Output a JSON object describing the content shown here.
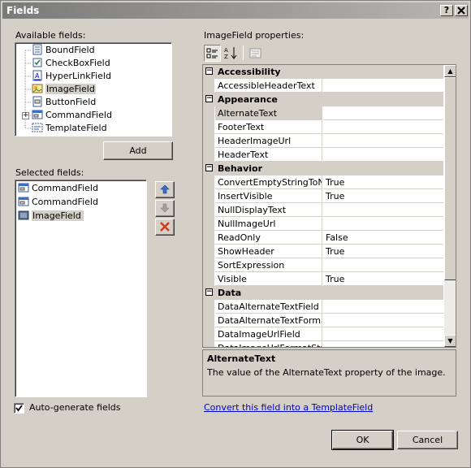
{
  "window": {
    "title": "Fields",
    "help_button": "?",
    "close_button": "X"
  },
  "available": {
    "label": "Available fields:",
    "items": [
      "BoundField",
      "CheckBoxField",
      "HyperLinkField",
      "ImageField",
      "ButtonField",
      "CommandField",
      "TemplateField"
    ]
  },
  "add_button": "Add",
  "selected": {
    "label": "Selected fields:",
    "items": [
      "CommandField",
      "CommandField",
      "ImageField"
    ]
  },
  "autogen": {
    "label": "Auto-generate fields",
    "checked": true
  },
  "properties": {
    "label": "ImageField properties:",
    "categories": [
      {
        "name": "Accessibility",
        "items": [
          {
            "name": "AccessibleHeaderText",
            "value": ""
          }
        ]
      },
      {
        "name": "Appearance",
        "items": [
          {
            "name": "AlternateText",
            "value": ""
          },
          {
            "name": "FooterText",
            "value": ""
          },
          {
            "name": "HeaderImageUrl",
            "value": ""
          },
          {
            "name": "HeaderText",
            "value": ""
          }
        ]
      },
      {
        "name": "Behavior",
        "items": [
          {
            "name": "ConvertEmptyStringToNull",
            "value": "True"
          },
          {
            "name": "InsertVisible",
            "value": "True"
          },
          {
            "name": "NullDisplayText",
            "value": ""
          },
          {
            "name": "NullImageUrl",
            "value": ""
          },
          {
            "name": "ReadOnly",
            "value": "False"
          },
          {
            "name": "ShowHeader",
            "value": "True"
          },
          {
            "name": "SortExpression",
            "value": ""
          },
          {
            "name": "Visible",
            "value": "True"
          }
        ]
      },
      {
        "name": "Data",
        "items": [
          {
            "name": "DataAlternateTextField",
            "value": ""
          },
          {
            "name": "DataAlternateTextFormatString",
            "value": ""
          },
          {
            "name": "DataImageUrlField",
            "value": ""
          },
          {
            "name": "DataImageUrlFormatString",
            "value": ""
          }
        ]
      }
    ]
  },
  "description": {
    "title": "AlternateText",
    "text": "The value of the AlternateText property of the image."
  },
  "convert_link": "Convert this field into a TemplateField",
  "ok_button": "OK",
  "cancel_button": "Cancel",
  "colors": {
    "selection": "#316ac5",
    "link": "#0000cc",
    "delete": "#d43a1c",
    "arrow": "#3a6fc4"
  }
}
